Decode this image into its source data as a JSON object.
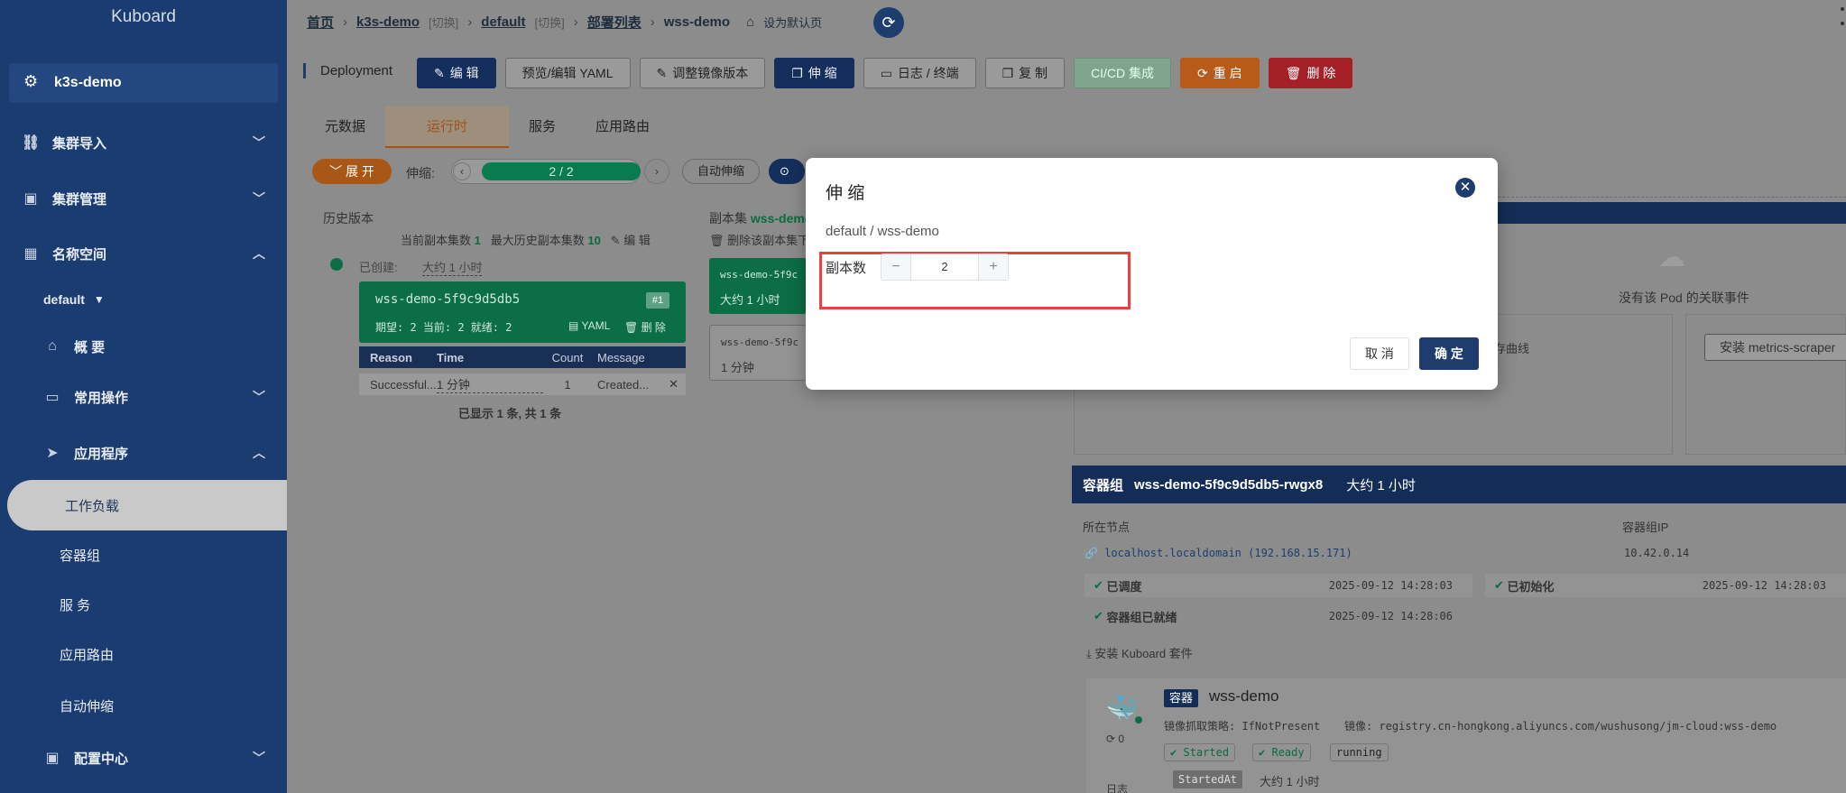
{
  "sidebar": {
    "logo": "Kuboard",
    "cluster": "k3s-demo",
    "menu": {
      "import": "集群导入",
      "manage": "集群管理",
      "namespace": "名称空间",
      "ns_value": "default",
      "overview": "概 要",
      "common": "常用操作",
      "apps": "应用程序",
      "workload": "工作负载",
      "pods": "容器组",
      "services": "服 务",
      "ingress": "应用路由",
      "autoscale": "自动伸缩",
      "config": "配置中心"
    }
  },
  "breadcrumb": {
    "home": "首页",
    "cluster": "k3s-demo",
    "switch1": "[切换]",
    "ns": "default",
    "switch2": "[切换]",
    "list": "部署列表",
    "current": "wss-demo",
    "set_default": "设为默认页"
  },
  "toolbar": {
    "kind": "Deployment",
    "edit": "编 辑",
    "yaml": "预览/编辑 YAML",
    "image": "调整镜像版本",
    "scale": "伸 缩",
    "logs": "日志 / 终端",
    "copy": "复 制",
    "cicd": "CI/CD 集成",
    "restart": "重 启",
    "delete": "删 除"
  },
  "tabs": [
    "元数据",
    "运行时",
    "服务",
    "应用路由"
  ],
  "runtime": {
    "expand": "展 开",
    "scale_label": "伸缩:",
    "progress": "2 / 2",
    "auto": "自动伸缩"
  },
  "history": {
    "title": "历史版本",
    "current_label": "当前副本集数",
    "current_value": "1",
    "max_label": "最大历史副本集数",
    "max_value": "10",
    "edit": "编 辑",
    "created_label": "已创建:",
    "created_value": "大约 1 小时",
    "rs_name": "wss-demo-5f9c9d5db5",
    "rs_badge": "#1",
    "rs_status": "期望: 2 当前: 2 就绪: 2",
    "rs_yaml": "YAML",
    "rs_delete": "删 除",
    "ev_cols": [
      "Reason",
      "Time",
      "Count",
      "Message"
    ],
    "ev_row": [
      "Successful...",
      "1 分钟",
      "1",
      "Created..."
    ],
    "summary": "已显示 1 条, 共 1 条"
  },
  "replicaset": {
    "title": "副本集",
    "name": "wss-demo",
    "delete_label": "删除该副本集下",
    "card1_name": "wss-demo-5f9c",
    "card1_time": "大约 1 小时",
    "card2_name": "wss-demo-5f9c",
    "card2_time": "1 分钟"
  },
  "right": {
    "no_events": "没有该 Pod 的关联事件",
    "curve": "存曲线",
    "install_metrics": "安装 metrics-scraper"
  },
  "pod": {
    "label": "容器组",
    "name": "wss-demo-5f9c9d5db5-rwgx8",
    "age": "大约 1 小时",
    "node_label": "所在节点",
    "ip_label": "容器组IP",
    "node_value": "localhost.localdomain (192.168.15.171)",
    "ip_value": "10.42.0.14",
    "scheduled": "已调度",
    "scheduled_time": "2025-09-12 14:28:03",
    "initialized": "已初始化",
    "initialized_time": "2025-09-12 14:28:03",
    "ready": "容器组已就绪",
    "ready_time": "2025-09-12 14:28:06",
    "install_suite": "安装 Kuboard 套件",
    "container_badge": "容器",
    "container_name": "wss-demo",
    "pull_policy": "镜像抓取策略: IfNotPresent",
    "image": "镜像: registry.cn-hongkong.aliyuncs.com/wushusong/jm-cloud:wss-demo",
    "restarts": "0",
    "tag_started": "Started",
    "tag_ready": "Ready",
    "tag_running": "running",
    "started_at_label": "StartedAt",
    "started_at_value": "大约 1 小时",
    "log_label": "日志"
  },
  "modal": {
    "title": "伸 缩",
    "subtitle": "default / wss-demo",
    "replica_label": "副本数",
    "minus": "−",
    "plus": "+",
    "replica_value": "2",
    "cancel": "取 消",
    "ok": "确 定"
  },
  "colors": {
    "sidebar": "#1b3c70",
    "primary": "#1f3c6e",
    "highlight": "#e94242"
  }
}
